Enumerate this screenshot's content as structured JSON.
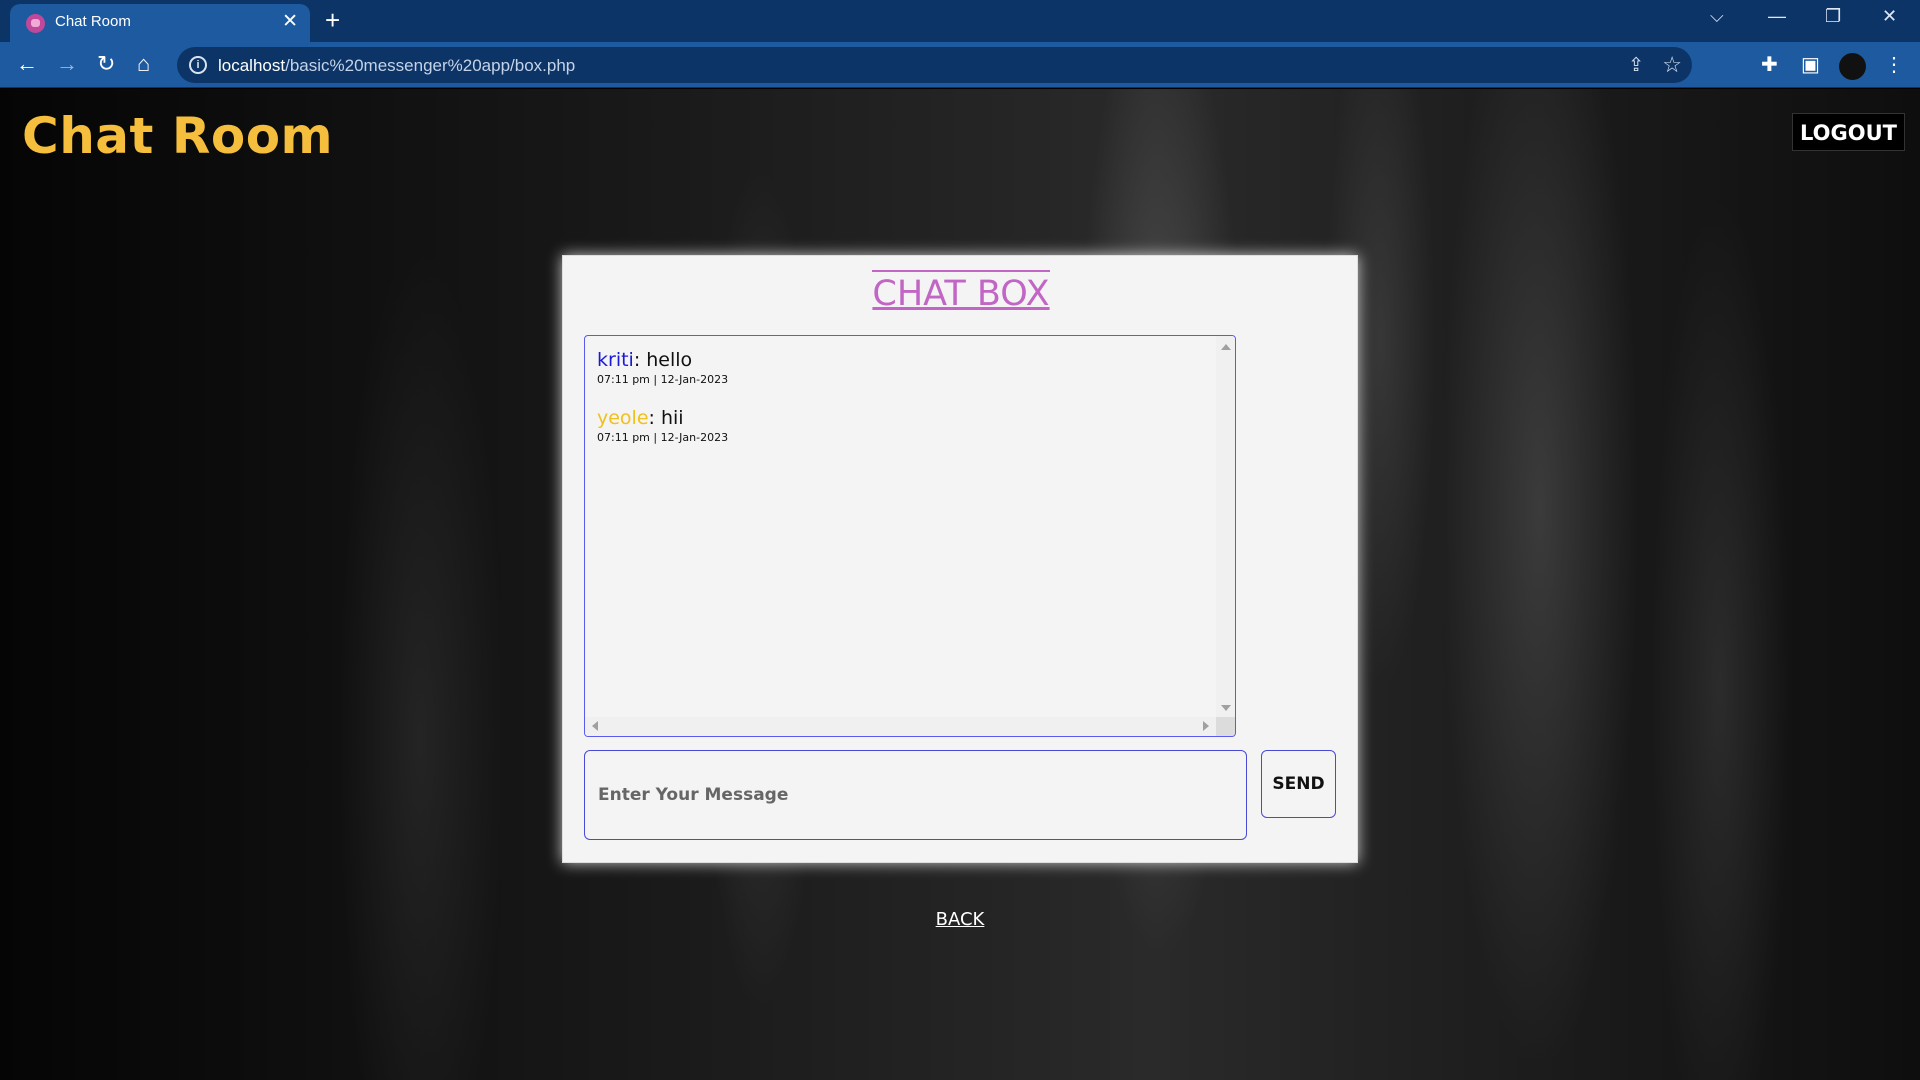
{
  "browser": {
    "tab_title": "Chat Room",
    "url_domain": "localhost",
    "url_path": "/basic%20messenger%20app/box.php"
  },
  "page": {
    "brand": "Chat Room",
    "logout_label": "LOGOUT",
    "back_label": "BACK"
  },
  "chat": {
    "title": "CHAT BOX",
    "messages": [
      {
        "user": "kriti",
        "user_color": "#1a1ad6",
        "text": ": hello",
        "time": "07:11 pm | 12-Jan-2023"
      },
      {
        "user": "yeole",
        "user_color": "#f2c01c",
        "text": ": hii",
        "time": "07:11 pm | 12-Jan-2023"
      }
    ],
    "input_placeholder": "Enter Your Message",
    "send_label": "SEND"
  },
  "colors": {
    "brand": "#f5be3c",
    "chat_title": "#c266c5",
    "border": "#4a4ad6"
  }
}
